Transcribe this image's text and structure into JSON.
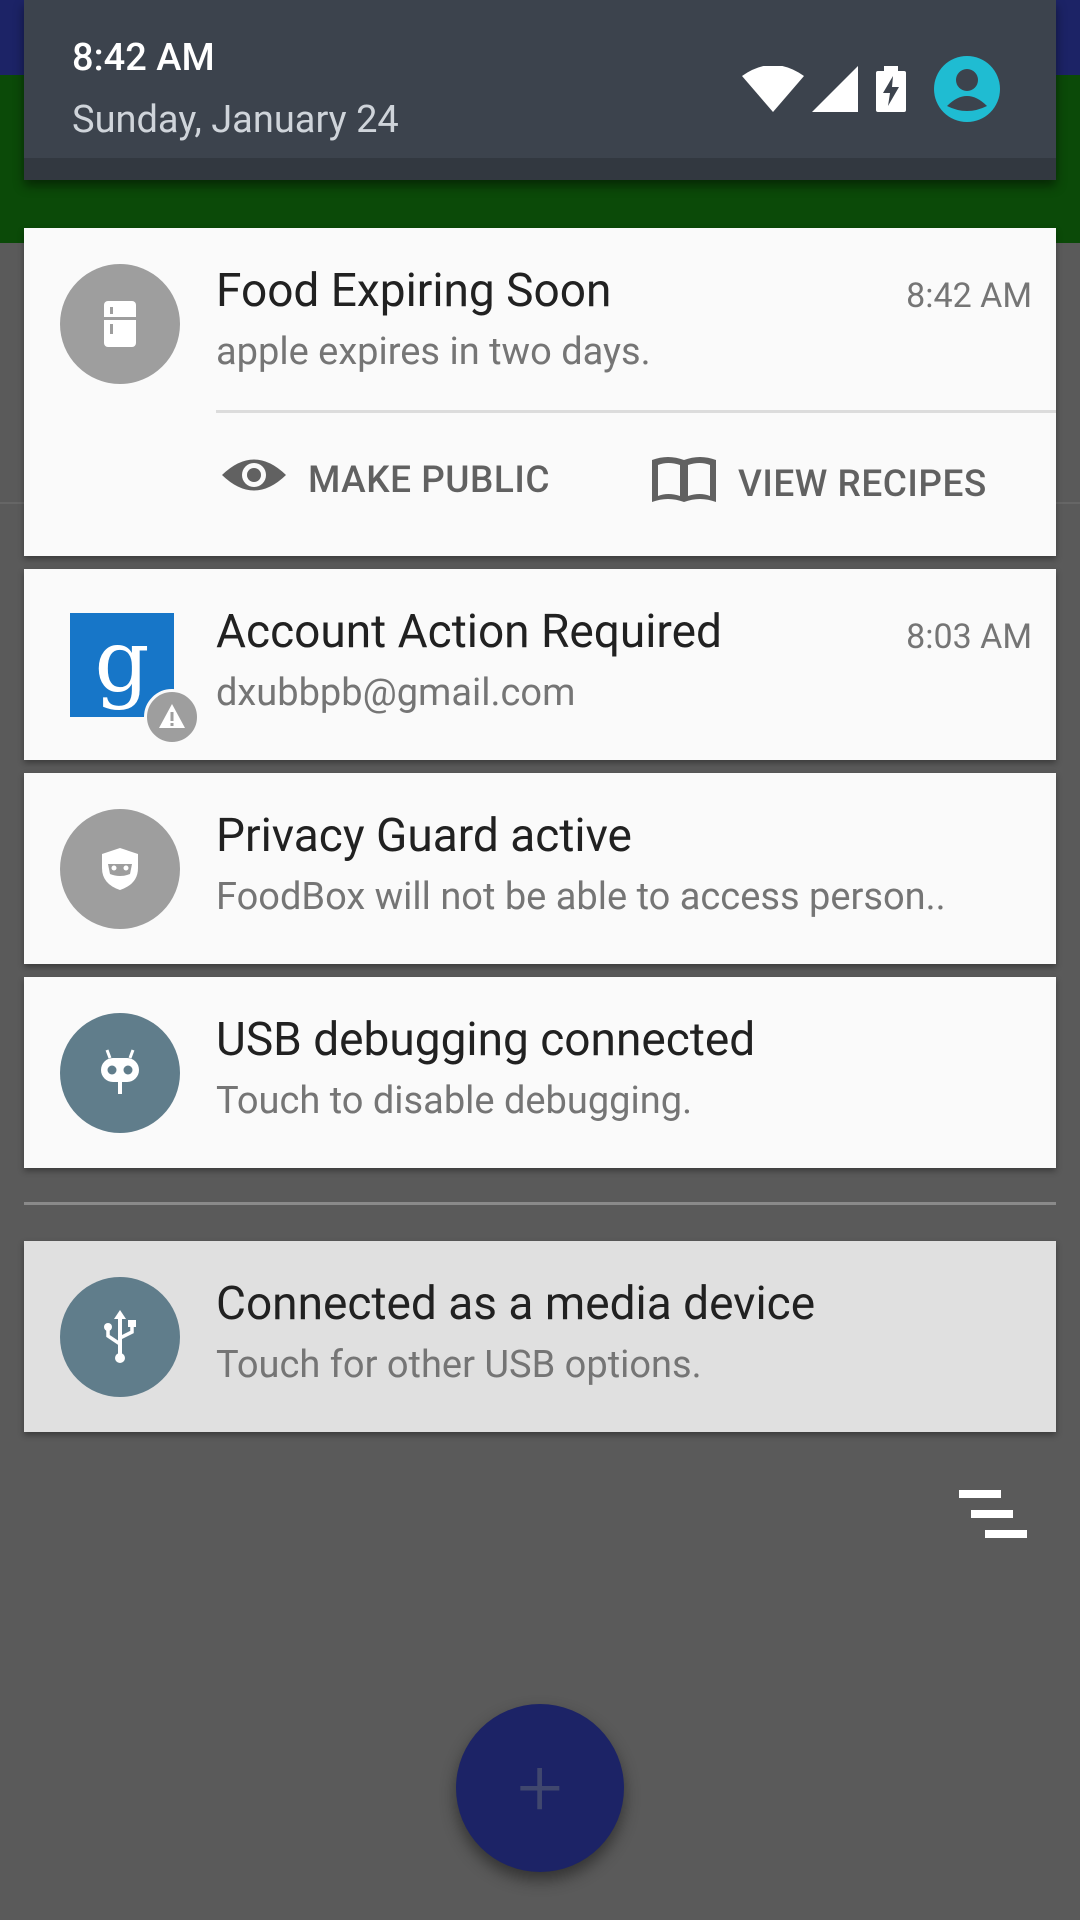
{
  "status": {
    "time": "8:42 AM",
    "date": "Sunday, January 24",
    "icons": [
      "wifi-icon",
      "cell-signal-icon",
      "battery-charging-icon",
      "user-account-icon"
    ],
    "accent": "#1fbcd2"
  },
  "notifications": [
    {
      "title": "Food Expiring Soon",
      "text": "apple expires in two days.",
      "time": "8:42 AM",
      "icon": "fridge-icon",
      "actions": [
        {
          "label": "MAKE PUBLIC",
          "icon": "eye-icon"
        },
        {
          "label": "VIEW RECIPES",
          "icon": "book-icon"
        }
      ]
    },
    {
      "title": "Account Action Required",
      "text": "dxubbpb@gmail.com",
      "time": "8:03 AM",
      "icon": "google-g-icon",
      "badge_icon": "warning-icon"
    },
    {
      "title": "Privacy Guard active",
      "text": "FoodBox will not be able to access person..",
      "icon": "privacy-guard-icon"
    },
    {
      "title": "USB debugging connected",
      "text": "Touch to disable debugging.",
      "icon": "android-debug-icon"
    },
    {
      "title": "Connected as a media device",
      "text": "Touch for other USB options.",
      "icon": "usb-icon"
    }
  ],
  "controls": {
    "dismiss_all_icon": "clear-all-icon",
    "fab_label": "+"
  },
  "colors": {
    "card_bg": "#fafafa",
    "header_bg": "#3c434d",
    "app_primary": "#1c2366",
    "app_green": "#0b4a08"
  }
}
